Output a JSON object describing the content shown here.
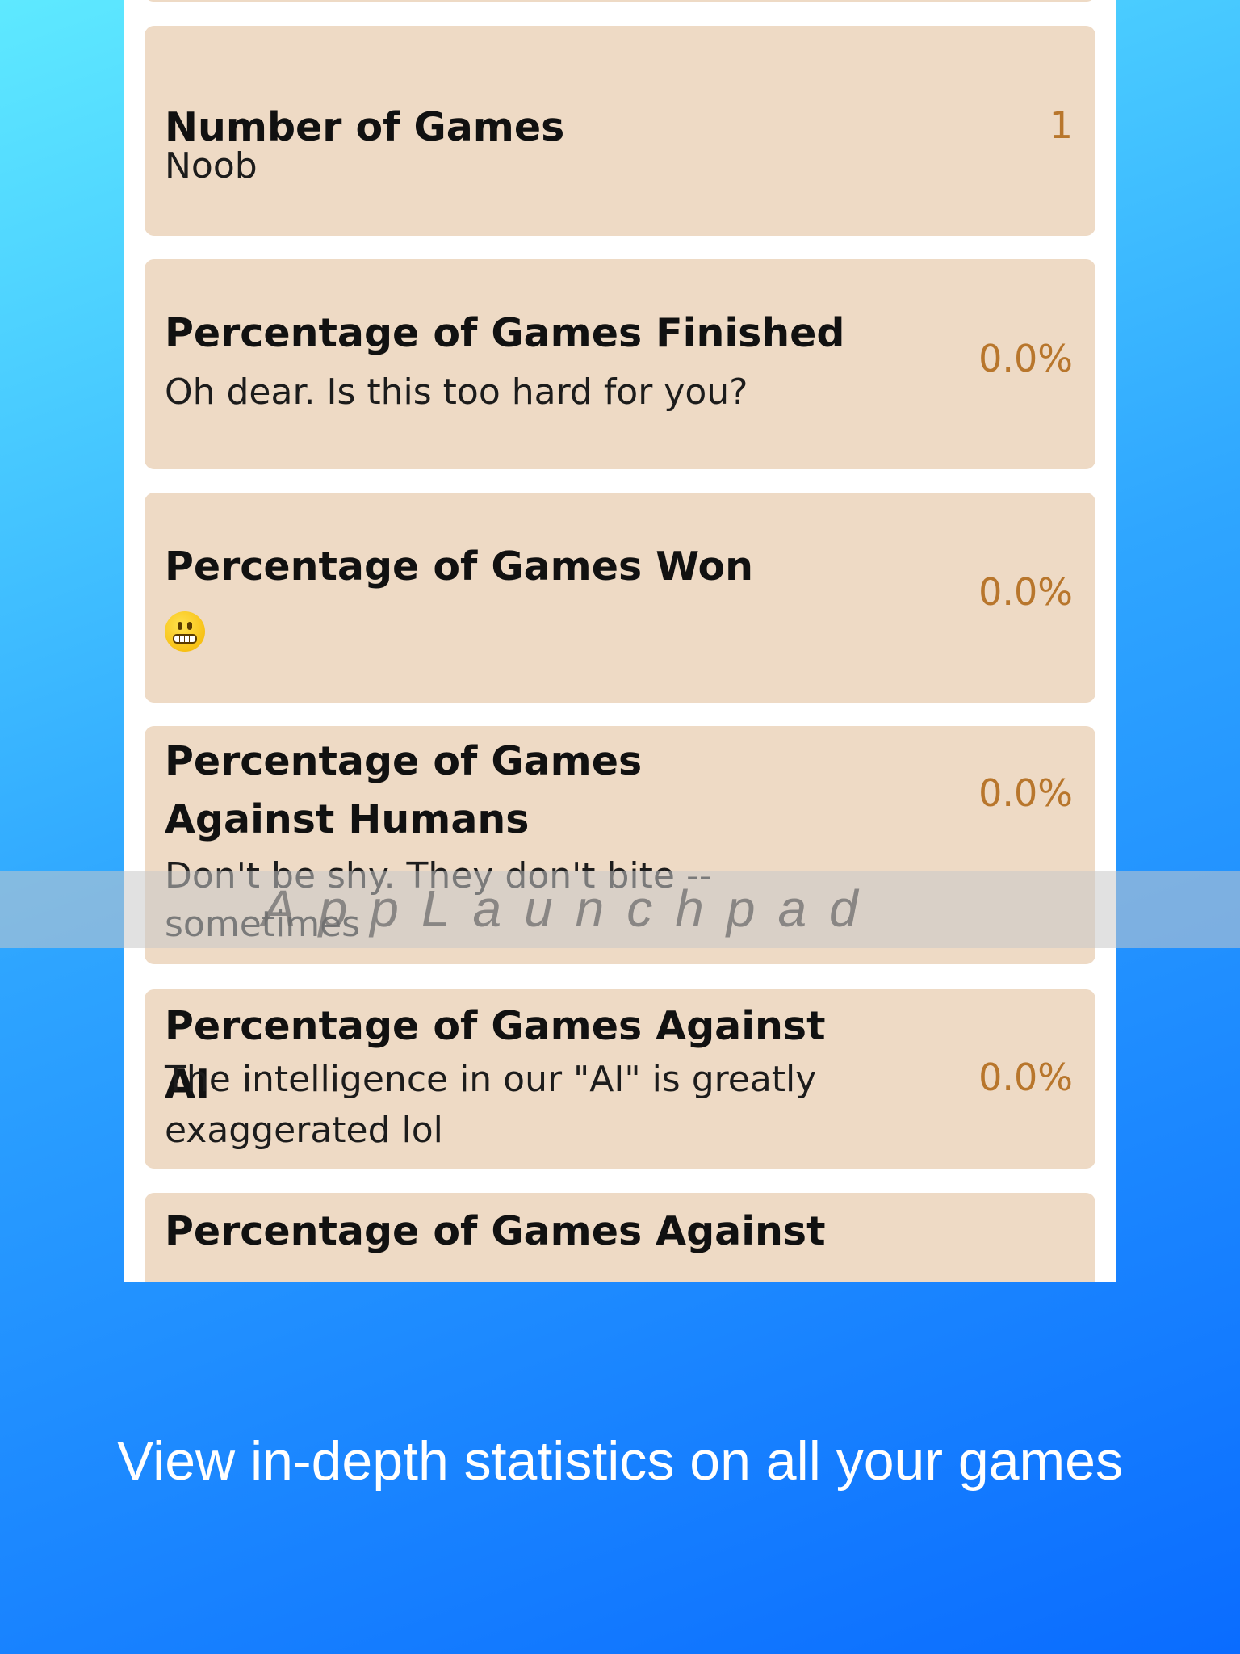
{
  "stats": [
    {
      "title": "Number of Games",
      "subtitle": "Noob",
      "value": "1"
    },
    {
      "title": "Percentage of Games Finished",
      "subtitle": "Oh dear. Is this too hard for you?",
      "value": "0.0%"
    },
    {
      "title": "Percentage of Games Won",
      "subtitle_icon": "grimacing-face-emoji",
      "value": "0.0%"
    },
    {
      "title": "Percentage of Games Against Humans",
      "subtitle": "Don't be shy. They don't bite -- sometimes",
      "value": "0.0%"
    },
    {
      "title": "Percentage of Games Against AI",
      "subtitle": "The intelligence in our \"AI\" is greatly exaggerated lol",
      "value": "0.0%"
    },
    {
      "title": "Percentage of Games Against"
    }
  ],
  "watermark": "AppLaunchpad",
  "caption": "View in-depth statistics on all your games",
  "colors": {
    "card_bg": "#eedac5",
    "value_text": "#b8762c",
    "background_top": "#5ee9ff",
    "background_bottom": "#0a6cff"
  }
}
